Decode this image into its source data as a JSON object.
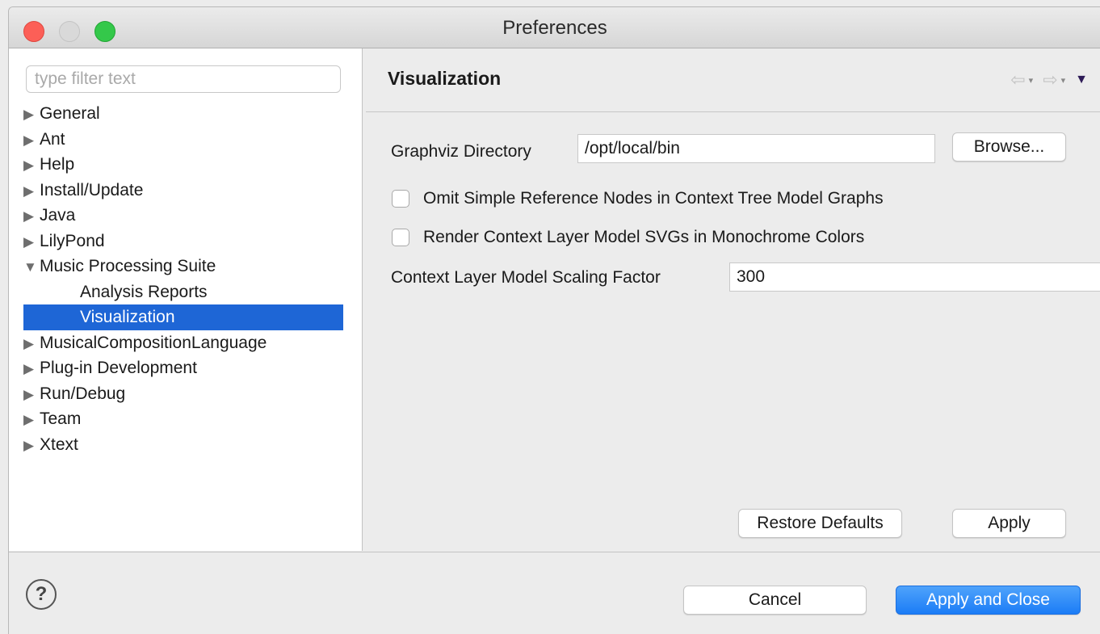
{
  "window": {
    "title": "Preferences"
  },
  "sidebar": {
    "filter_placeholder": "type filter text",
    "items": [
      {
        "label": "General",
        "arrow": "▶"
      },
      {
        "label": "Ant",
        "arrow": "▶"
      },
      {
        "label": "Help",
        "arrow": "▶"
      },
      {
        "label": "Install/Update",
        "arrow": "▶"
      },
      {
        "label": "Java",
        "arrow": "▶"
      },
      {
        "label": "LilyPond",
        "arrow": "▶"
      },
      {
        "label": "Music Processing Suite",
        "arrow": "▼"
      },
      {
        "label": "Analysis Reports"
      },
      {
        "label": "Visualization"
      },
      {
        "label": "MusicalCompositionLanguage",
        "arrow": "▶"
      },
      {
        "label": "Plug-in Development",
        "arrow": "▶"
      },
      {
        "label": "Run/Debug",
        "arrow": "▶"
      },
      {
        "label": "Team",
        "arrow": "▶"
      },
      {
        "label": "Xtext",
        "arrow": "▶"
      }
    ]
  },
  "page": {
    "title": "Visualization",
    "nav": {
      "back_icon": "⇦",
      "forward_icon": "⇨",
      "dropdown_icon": "▾",
      "menu_icon": "▼"
    },
    "graphviz_label": "Graphviz Directory",
    "graphviz_value": "/opt/local/bin",
    "browse_label": "Browse...",
    "omit_nodes_label": "Omit Simple Reference Nodes in Context Tree Model Graphs",
    "monochrome_label": "Render Context Layer Model SVGs in Monochrome Colors",
    "scaling_label": "Context Layer Model Scaling Factor",
    "scaling_value": "300",
    "restore_label": "Restore Defaults",
    "apply_label": "Apply"
  },
  "footer": {
    "help_icon": "?",
    "cancel_label": "Cancel",
    "apply_close_label": "Apply and Close"
  },
  "colors": {
    "selection": "#1e66d6",
    "primary_button": "#1b7cf6",
    "close": "#fc5f57",
    "maximize": "#34c84a"
  }
}
